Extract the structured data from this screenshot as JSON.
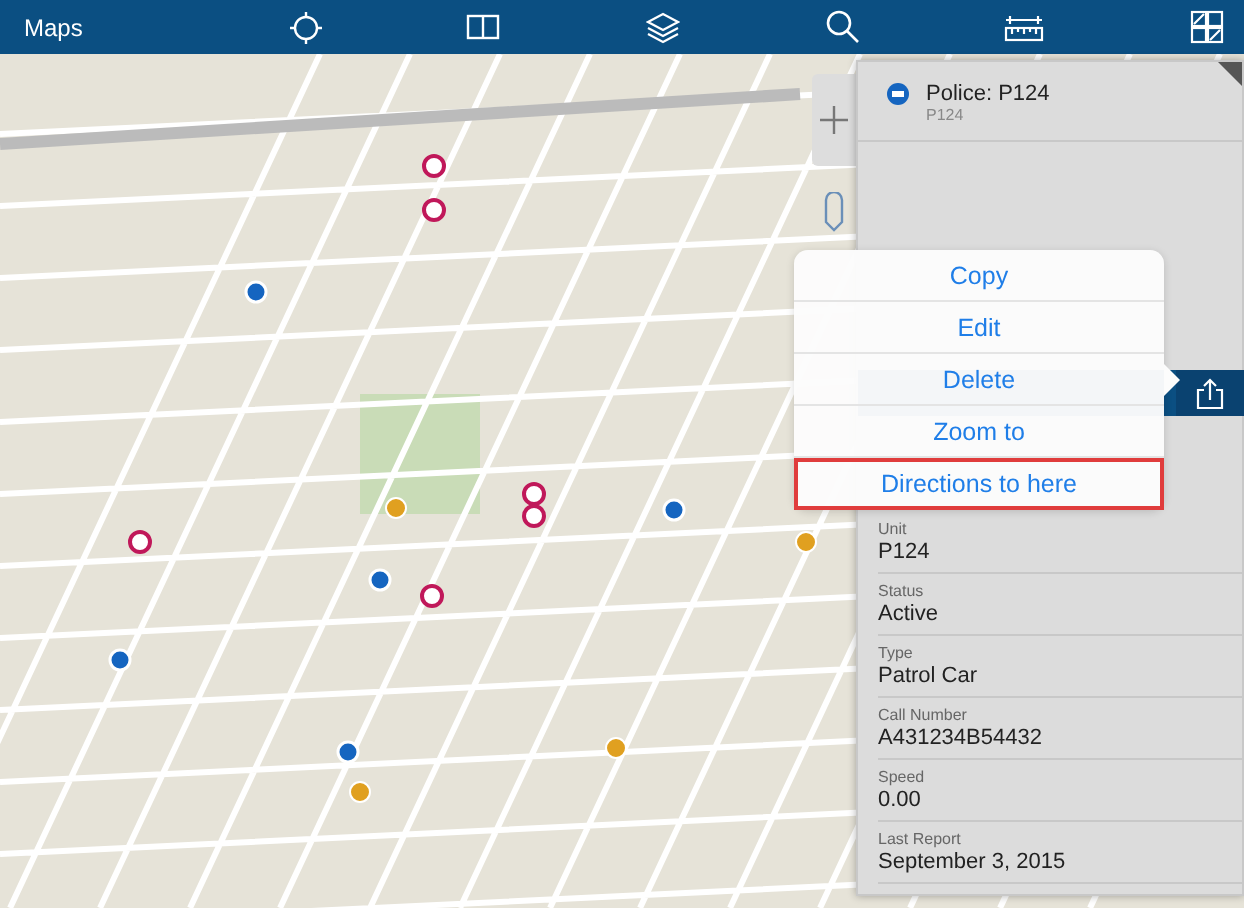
{
  "toolbar": {
    "title": "Maps"
  },
  "feature": {
    "title": "Police: P124",
    "subtitle": "P124"
  },
  "context_menu": [
    {
      "label": "Copy",
      "selected": false
    },
    {
      "label": "Edit",
      "selected": false
    },
    {
      "label": "Delete",
      "selected": false
    },
    {
      "label": "Zoom to",
      "selected": false
    },
    {
      "label": "Directions to here",
      "selected": true
    }
  ],
  "details": [
    {
      "label": "Unit",
      "value": "P124"
    },
    {
      "label": "Status",
      "value": "Active"
    },
    {
      "label": "Type",
      "value": "Patrol Car"
    },
    {
      "label": "Call Number",
      "value": "A431234B54432"
    },
    {
      "label": "Speed",
      "value": "0.00"
    },
    {
      "label": "Last Report",
      "value": "September 3, 2015"
    }
  ]
}
